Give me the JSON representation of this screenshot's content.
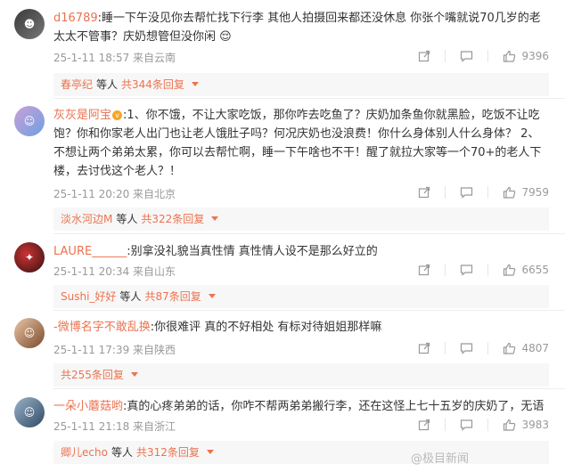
{
  "comments": [
    {
      "username": "d16789",
      "content": "睡一下午没见你去帮忙找下行李 其他人拍摄回来都还没休息 你张个嘴就说70几岁的老太太不管事？庆奶想管但没你闲 😌",
      "time": "25-1-11 18:57 来自云南",
      "likes": "9396",
      "reply_user": "春亭纪",
      "reply_mid": "等人",
      "reply_count": "共344条回复"
    },
    {
      "username": "灰灰是阿宝",
      "content": "1、你不饿，不让大家吃饭，那你咋去吃鱼了？庆奶加条鱼你就黑脸，吃饭不让吃饱？你和你家老人出门也让老人饿肚子吗？何况庆奶也没浪费！你什么身体别人什么身体？ 2、不想让两个弟弟太累，你可以去帮忙啊，睡一下午啥也不干！醒了就拉大家等一个70+的老人下楼，去讨伐这个老人？！",
      "time": "25-1-11 20:20 来自北京",
      "likes": "7959",
      "reply_user": "淡水河边M",
      "reply_mid": "等人",
      "reply_count": "共322条回复"
    },
    {
      "username": "LAURE______",
      "content": "别拿没礼貌当真性情  真性情人设不是那么好立的",
      "time": "25-1-11 20:34 来自山东",
      "likes": "6655",
      "reply_user": "Sushi_好好",
      "reply_mid": "等人",
      "reply_count": "共87条回复"
    },
    {
      "username": "-微博名字不敢乱换",
      "content": "你很难评 真的不好相处 有标对待姐姐那样嘛",
      "time": "25-1-11 17:39 来自陕西",
      "likes": "4807",
      "reply_user": "",
      "reply_mid": "",
      "reply_count": "共255条回复"
    },
    {
      "username": "一朵小蘑菇哟",
      "content": "真的心疼弟弟的话，你咋不帮两弟弟搬行李，还在这怪上七十五岁的庆奶了，无语",
      "time": "25-1-11 21:18 来自浙江",
      "likes": "3983",
      "reply_user": "卿儿echo",
      "reply_mid": "等人",
      "reply_count": "共312条回复"
    }
  ],
  "watermark": "@极目新闻",
  "icons": {
    "share": "share-icon",
    "comment": "comment-icon",
    "like": "thumbs-up-icon",
    "dropdown": "caret-down-icon",
    "verified": "verified-badge-icon"
  },
  "colors": {
    "username": "#eb7350",
    "meta": "#999999",
    "reply_bg": "#f7f7f7"
  }
}
